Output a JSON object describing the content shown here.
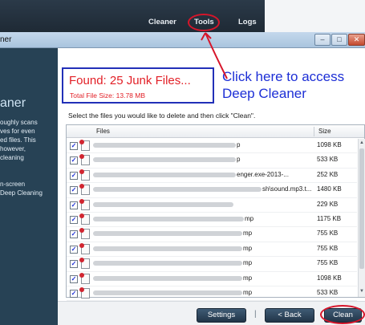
{
  "top_nav": {
    "cleaner": "Cleaner",
    "tools": "Tools",
    "logs": "Logs"
  },
  "window": {
    "title": "ner"
  },
  "sidebar": {
    "heading": "aner",
    "lines_a": [
      "oughly scans",
      "ves for even",
      "ed files.  This",
      "however,",
      " cleaning"
    ],
    "lines_b": [
      "n-screen",
      "Deep Cleaning"
    ]
  },
  "summary": {
    "found": "Found: 25 Junk Files...",
    "total_size": "Total File Size: 13.78 MB"
  },
  "callout": {
    "line1": "Click here to access",
    "line2": "Deep Cleaner"
  },
  "instruction": "Select the files you would like to delete and then click \"Clean\".",
  "table": {
    "columns": [
      "Files",
      "Size"
    ],
    "rows": [
      {
        "checked": true,
        "path_end": "p",
        "size": "1098 KB"
      },
      {
        "checked": true,
        "path_end": "p",
        "size": "533 KB"
      },
      {
        "checked": true,
        "path_end": "enger.exe-2013-...",
        "size": "252 KB"
      },
      {
        "checked": true,
        "path_end": "sh\\sound.mp3.t...",
        "size": "1480 KB"
      },
      {
        "checked": true,
        "path_end": "",
        "size": "229 KB"
      },
      {
        "checked": true,
        "path_end": "mp",
        "size": "1175 KB"
      },
      {
        "checked": true,
        "path_end": "mp",
        "size": "755 KB"
      },
      {
        "checked": true,
        "path_end": "mp",
        "size": "755 KB"
      },
      {
        "checked": true,
        "path_end": "mp",
        "size": "755 KB"
      },
      {
        "checked": true,
        "path_end": "mp",
        "size": "1098 KB"
      },
      {
        "checked": true,
        "path_end": "mp",
        "size": "533 KB"
      }
    ]
  },
  "buttons": {
    "settings": "Settings",
    "separator": "|",
    "back": "< Back",
    "clean": "Clean"
  },
  "win_controls": {
    "minimize": "–",
    "maximize": "□",
    "close": "✕"
  },
  "scroll": {
    "up": "▲",
    "down": "▼"
  },
  "colors": {
    "accent_red": "#e21f26",
    "annotation_blue": "#1d2fd6",
    "sidebar": "#274255",
    "button": "#2d4560"
  }
}
